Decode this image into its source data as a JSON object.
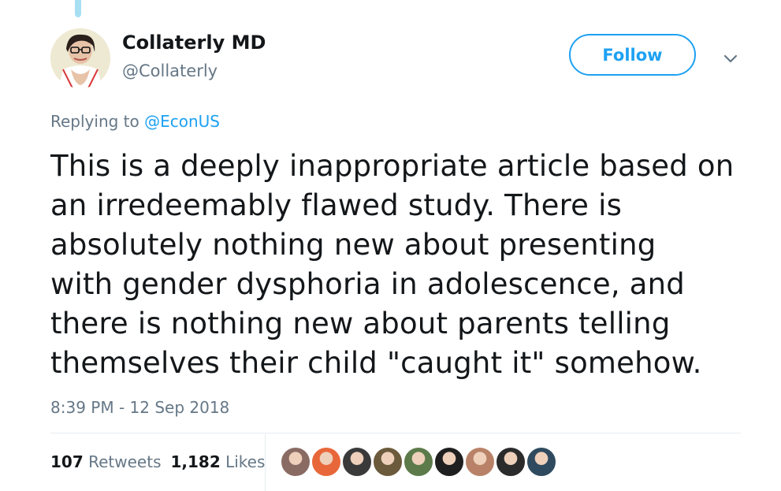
{
  "author": {
    "display_name": "Collaterly MD",
    "handle": "@Collaterly"
  },
  "follow_button": {
    "label": "Follow"
  },
  "reply_context": {
    "prefix": "Replying to ",
    "mention": "@EconUS"
  },
  "tweet": {
    "lines": [
      "This is a deeply inappropriate article based on",
      "an irredeemably flawed study. There is",
      "absolutely nothing new about presenting",
      "with gender dysphoria in adolescence, and",
      "there is nothing new about parents telling",
      "themselves their child \"caught it\" somehow."
    ],
    "timestamp": "8:39 PM - 12 Sep 2018"
  },
  "stats": {
    "retweets_count": "107",
    "retweets_label": "Retweets",
    "likes_count": "1,182",
    "likes_label": "Likes"
  },
  "colors": {
    "accent": "#1da1f2",
    "secondary_text": "#657786",
    "primary_text": "#14171a",
    "divider": "#e6ecf0"
  },
  "icons": {
    "caret": "chevron-down-icon"
  },
  "liker_avatars": [
    {
      "name": "liker-avatar-1",
      "color": "#8a6b64"
    },
    {
      "name": "liker-avatar-2",
      "color": "#e8673a"
    },
    {
      "name": "liker-avatar-3",
      "color": "#3a3a3a"
    },
    {
      "name": "liker-avatar-4",
      "color": "#6b5a3c"
    },
    {
      "name": "liker-avatar-5",
      "color": "#5c7a4a"
    },
    {
      "name": "liker-avatar-6",
      "color": "#1f1f1f"
    },
    {
      "name": "liker-avatar-7",
      "color": "#b98268"
    },
    {
      "name": "liker-avatar-8",
      "color": "#2b2b2b"
    },
    {
      "name": "liker-avatar-9",
      "color": "#2f4a5e"
    }
  ]
}
